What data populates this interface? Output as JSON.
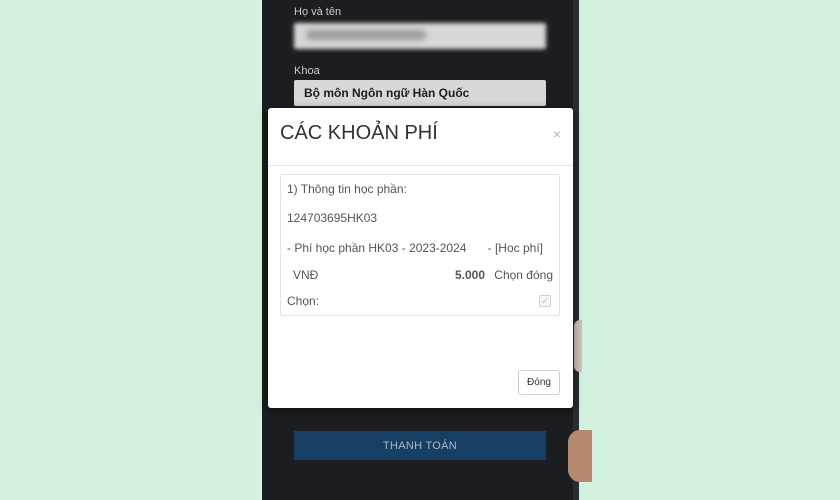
{
  "background_form": {
    "full_name_label": "Họ và tên",
    "faculty_label": "Khoa",
    "faculty_value": "Bộ môn Ngôn ngữ Hàn Quốc",
    "pay_button_label": "THANH TOÁN"
  },
  "modal": {
    "title": "CÁC KHOẢN PHÍ",
    "close_glyph": "×",
    "section_title": "1) Thông tin học phần:",
    "course_code": "124703695HK03",
    "fee_line": "-  Phí học phần HK03 - 2023-2024",
    "fee_tag": "-  [Hoc phí]",
    "currency": "VNĐ",
    "amount": "5.000",
    "choose_pay_label": "Chọn đóng",
    "choose_label": "Chọn:",
    "checkbox_glyph": "✓",
    "close_button_label": "Đóng"
  },
  "colors": {
    "page_background": "#d3f3e0",
    "pay_button": "#173e63"
  }
}
